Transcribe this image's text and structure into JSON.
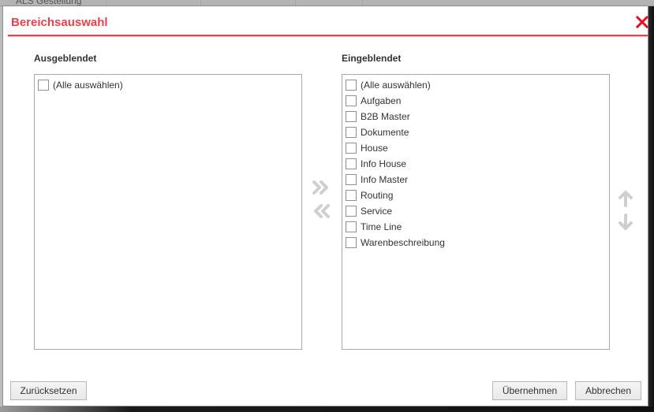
{
  "background": {
    "cells": [
      "ALS Gestellung",
      "",
      "",
      ""
    ]
  },
  "dialog": {
    "title": "Bereichsauswahl",
    "close_icon": "close-icon",
    "accent_color": "#e8414b"
  },
  "hidden_panel": {
    "label": "Ausgeblendet",
    "items": [
      {
        "label": "(Alle auswählen)",
        "checked": false
      }
    ]
  },
  "visible_panel": {
    "label": "Eingeblendet",
    "items": [
      {
        "label": "(Alle auswählen)",
        "checked": false
      },
      {
        "label": "Aufgaben",
        "checked": false
      },
      {
        "label": "B2B Master",
        "checked": false
      },
      {
        "label": "Dokumente",
        "checked": false
      },
      {
        "label": "House",
        "checked": false
      },
      {
        "label": "Info House",
        "checked": false
      },
      {
        "label": "Info Master",
        "checked": false
      },
      {
        "label": "Routing",
        "checked": false
      },
      {
        "label": "Service",
        "checked": false
      },
      {
        "label": "Time Line",
        "checked": false
      },
      {
        "label": "Warenbeschreibung",
        "checked": false
      }
    ]
  },
  "transfer_buttons": {
    "move_right_icon": "double-chevron-right-icon",
    "move_left_icon": "double-chevron-left-icon",
    "enabled": false
  },
  "order_buttons": {
    "move_up_icon": "arrow-up-icon",
    "move_down_icon": "arrow-down-icon",
    "enabled": false
  },
  "footer": {
    "reset_label": "Zurücksetzen",
    "apply_label": "Übernehmen",
    "cancel_label": "Abbrechen"
  }
}
